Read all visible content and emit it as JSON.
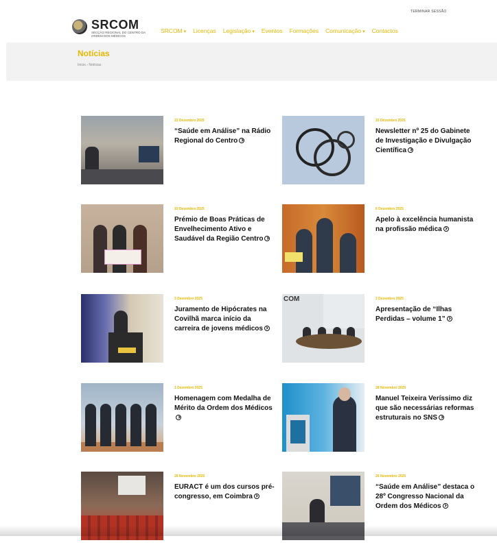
{
  "header": {
    "logo_title": "SRCOM",
    "logo_subtitle": "Secção Regional do Centro da Ordem dos Médicos",
    "top_link": "Terminar sessão",
    "nav": [
      {
        "label": "SRCOM",
        "dropdown": true
      },
      {
        "label": "Licenças",
        "dropdown": false
      },
      {
        "label": "Legislação",
        "dropdown": true
      },
      {
        "label": "Eventos",
        "dropdown": false
      },
      {
        "label": "Formações",
        "dropdown": false
      },
      {
        "label": "Comunicação",
        "dropdown": true
      },
      {
        "label": "Contactos",
        "dropdown": false
      }
    ],
    "accent_color": "#e6b800"
  },
  "page": {
    "title": "Notícias",
    "breadcrumb": [
      "Início",
      "Notícias"
    ]
  },
  "news": [
    {
      "date": "22 Dezembro 2025",
      "title": "“Saúde em Análise” na Rádio Regional do Centro"
    },
    {
      "date": "15 Dezembro 2025",
      "title": "Newsletter nº 25 do Gabinete de Investigação e Divulgação Científica"
    },
    {
      "date": "10 Dezembro 2025",
      "title": "Prémio de Boas Práticas de Envelhecimento Ativo e Saudável da Região Centro"
    },
    {
      "date": "6 Dezembro 2025",
      "title": "Apelo à excelência humanista na profissão médica"
    },
    {
      "date": "3 Dezembro 2025",
      "title": "Juramento de Hipócrates na Covilhã marca início da carreira de jovens médicos"
    },
    {
      "date": "2 Dezembro 2025",
      "title": "Apresentação de “Ilhas Perdidas – volume 1”"
    },
    {
      "date": "1 Dezembro 2025",
      "title": "Homenagem com Medalha de Mérito da Ordem dos Médicos"
    },
    {
      "date": "28 Novembro 2025",
      "title": "Manuel Teixeira Veríssimo diz que são necessárias reformas estruturais no SNS"
    },
    {
      "date": "26 Novembro 2025",
      "title": "EURACT é um dos cursos pré-congresso, em Coimbra"
    },
    {
      "date": "26 Novembro 2025",
      "title": "“Saúde em Análise” destaca o 28º Congresso Nacional da Ordem dos Médicos"
    }
  ]
}
